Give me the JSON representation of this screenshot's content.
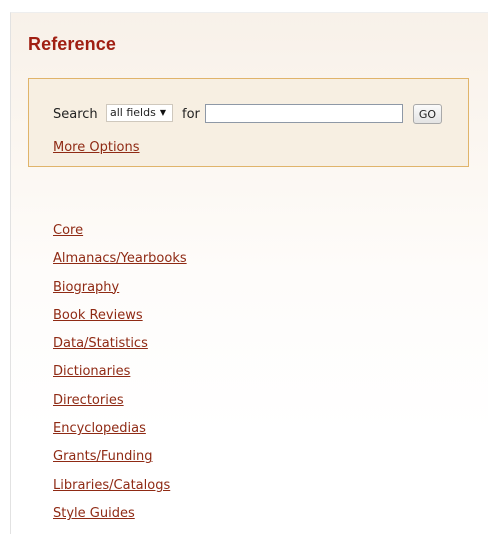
{
  "panel": {
    "title": "Reference"
  },
  "search": {
    "label": "Search",
    "field_select": {
      "selected": "all fields"
    },
    "for_label": "for",
    "query_value": "",
    "go_label": "GO",
    "more_options_label": "More Options"
  },
  "nav": {
    "items": [
      {
        "label": "Core"
      },
      {
        "label": "Almanacs/Yearbooks"
      },
      {
        "label": "Biography"
      },
      {
        "label": "Book Reviews"
      },
      {
        "label": "Data/Statistics"
      },
      {
        "label": "Dictionaries"
      },
      {
        "label": "Directories"
      },
      {
        "label": "Encyclopedias"
      },
      {
        "label": "Grants/Funding"
      },
      {
        "label": "Libraries/Catalogs"
      },
      {
        "label": "Style Guides"
      }
    ]
  },
  "colors": {
    "title": "#a01f12",
    "link": "#8f2a14",
    "search_border": "#e0b46a"
  }
}
